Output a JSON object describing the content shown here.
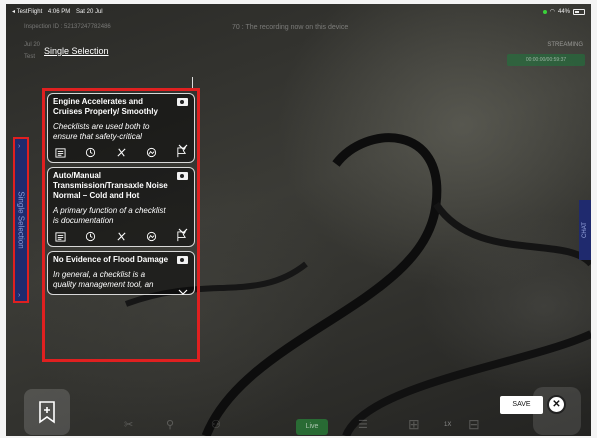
{
  "status_bar": {
    "carrier": "◂ TestFlight",
    "time": "4:06 PM",
    "date": "Sat 20 Jul",
    "battery": "44%"
  },
  "overlay": {
    "inspection_id": "Inspection ID : 52137247782486",
    "recording_notice": "70 : The recording now on this device",
    "line3": "Jul 20",
    "line4": "Test",
    "streaming": "STREAMING",
    "stream_time": "00:00:00/00:59:37"
  },
  "page_title": "Single Selection",
  "side_tab_label": "Single Selection",
  "chat_tab_label": "CHAT",
  "cards": [
    {
      "title": "Engine Accelerates and Cruises Properly/ Smoothly",
      "description": "Checklists are used both to ensure that safety-critical",
      "show_icons": true
    },
    {
      "title": "Auto/Manual Transmission/Transaxle Noise Normal – Cold and Hot",
      "description": "A primary function of a checklist is documentation",
      "show_icons": true
    },
    {
      "title": "No Evidence of Flood Damage",
      "description": "In general, a checklist is a quality management tool, an",
      "show_icons": false
    }
  ],
  "toolbar": {
    "live_label": "Live",
    "zoom_label": "1X",
    "save_label": "SAVE",
    "close_symbol": "✕"
  },
  "colors": {
    "highlight_border": "#e02020",
    "side_tab_bg": "#1f2a6e",
    "live_green": "#28963c"
  },
  "icons": [
    "checklist-icon",
    "history-icon",
    "tools-icon",
    "image-icon",
    "flag-icon",
    "camera-icon",
    "chevron-down-icon",
    "bookmark-add-icon",
    "close-icon"
  ]
}
